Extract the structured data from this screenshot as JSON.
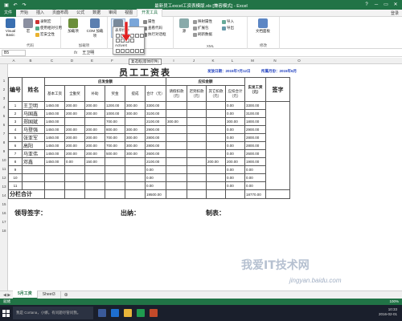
{
  "window": {
    "title": "最新员工excel工资表模版.xls  [兼容模式] - Excel",
    "signin": "登录"
  },
  "quick_access": {
    "save_icon": "save-icon",
    "undo": "↶",
    "redo": "↷"
  },
  "tabs": [
    "文件",
    "开始",
    "插入",
    "页面布局",
    "公式",
    "数据",
    "审阅",
    "视图",
    "开发工具"
  ],
  "active_tab": "开发工具",
  "ribbon": {
    "code": {
      "label": "代码",
      "visual_basic": "Visual Basic",
      "macro": "宏",
      "record": "录制宏",
      "relative": "使用相对引用",
      "security": "宏安全性"
    },
    "addins": {
      "label": "加载项",
      "addins": "加载项",
      "com": "COM 加载项"
    },
    "controls": {
      "label": "控件",
      "insert": "插入",
      "design": "设计模式",
      "props": "属性",
      "viewcode": "查看代码",
      "dialog": "执行对话框"
    },
    "xml": {
      "label": "XML",
      "source": "源",
      "map_props": "映射属性",
      "expand": "扩展包",
      "refresh": "刷新数据",
      "import": "导入",
      "export": "导出"
    },
    "modify": {
      "label": "修改",
      "panel": "文档面板"
    }
  },
  "dropdown": {
    "form_label": "表单控件",
    "activex_label": "ActiveX"
  },
  "tooltip": "复选框(窗体控件)",
  "formula_bar": {
    "name_box": "B5",
    "fx": "fx",
    "value": "王卫明"
  },
  "columns": [
    "A",
    "B",
    "C",
    "D",
    "E",
    "F",
    "G",
    "H",
    "I",
    "J",
    "K",
    "L",
    "M",
    "N",
    "O"
  ],
  "rows": [
    "1",
    "2",
    "3",
    "4",
    "5",
    "6",
    "7",
    "8",
    "9",
    "10",
    "11",
    "12",
    "13",
    "14",
    "15",
    "16",
    "17",
    "18"
  ],
  "sheet": {
    "title": "员工工资表",
    "dept": "发放日期：2015年7月12日",
    "period": "所属月份：2015年6月",
    "hdr_no": "编号",
    "hdr_name": "姓名",
    "hdr_payable": "应发金额",
    "hdr_deduct": "应扣金额",
    "hdr_actual": "实发工资（元）",
    "hdr_sign": "签字",
    "sub": [
      "基本工资",
      "全勤奖",
      "补助",
      "奖金",
      "提成",
      "合计（元）",
      "请假扣款（元）",
      "迟到扣款（元）",
      "其它扣款（元）",
      "应扣合计（元）"
    ],
    "employees": [
      {
        "no": "1",
        "name": "王卫明",
        "v": [
          "1450.00",
          "200.00",
          "200.00",
          "1200.00",
          "300.00",
          "3300.00",
          "",
          "",
          "",
          "0.00",
          "3300.00"
        ]
      },
      {
        "no": "2",
        "name": "马国鑫",
        "v": [
          "1450.00",
          "200.00",
          "200.00",
          "1000.00",
          "300.00",
          "3100.00",
          "",
          "",
          "",
          "0.00",
          "3100.00"
        ]
      },
      {
        "no": "3",
        "name": "郑国斌",
        "v": [
          "1450.00",
          "",
          "",
          "700.00",
          "",
          "2100.00",
          "300.00",
          "",
          "",
          "300.00",
          "1800.00"
        ]
      },
      {
        "no": "4",
        "name": "马登强",
        "v": [
          "1450.00",
          "200.00",
          "200.00",
          "800.00",
          "300.00",
          "2900.00",
          "",
          "",
          "",
          "0.00",
          "2900.00"
        ]
      },
      {
        "no": "5",
        "name": "张亚军",
        "v": [
          "1450.00",
          "200.00",
          "200.00",
          "700.00",
          "300.00",
          "2800.00",
          "",
          "",
          "",
          "0.00",
          "2800.00"
        ]
      },
      {
        "no": "6",
        "name": "高阳",
        "v": [
          "1450.00",
          "200.00",
          "200.00",
          "700.00",
          "300.00",
          "2800.00",
          "",
          "",
          "",
          "0.00",
          "2800.00"
        ]
      },
      {
        "no": "7",
        "name": "马亚伟",
        "v": [
          "1450.00",
          "200.00",
          "200.00",
          "500.00",
          "300.00",
          "2600.00",
          "",
          "",
          "",
          "0.00",
          "2600.00"
        ]
      },
      {
        "no": "8",
        "name": "邓鑫",
        "v": [
          "1450.00",
          "0.00",
          "150.00",
          "",
          "",
          "2100.00",
          "",
          "",
          "200.00",
          "200.00",
          "1900.00"
        ]
      },
      {
        "no": "9",
        "name": "",
        "v": [
          "",
          "",
          "",
          "",
          "",
          "0.00",
          "",
          "",
          "",
          "0.00",
          "0.00"
        ]
      },
      {
        "no": "10",
        "name": "",
        "v": [
          "",
          "",
          "",
          "",
          "",
          "0.00",
          "",
          "",
          "",
          "0.00",
          "0.00"
        ]
      },
      {
        "no": "11",
        "name": "",
        "v": [
          "",
          "",
          "",
          "",
          "",
          "0.00",
          "",
          "",
          "",
          "0.00",
          "0.00"
        ]
      }
    ],
    "total_label": "分栏合计",
    "total_sum": "19500.00",
    "total_actual": "18770.00",
    "sign_leader": "领导签字：",
    "sign_cashier": "出纳：",
    "sign_maker": "制表："
  },
  "sheet_tabs": [
    "5月工资",
    "Sheet3"
  ],
  "active_sheet": "5月工资",
  "status": {
    "text": "就绪",
    "zoom": "100%"
  },
  "taskbar": {
    "search": "我是 Cortana，小娜。有问题尽管问我。",
    "time": "10:33",
    "date": "2016-02-01"
  },
  "watermark": {
    "text": "我爱IT技术网",
    "url": "jingyan.baidu.com"
  }
}
